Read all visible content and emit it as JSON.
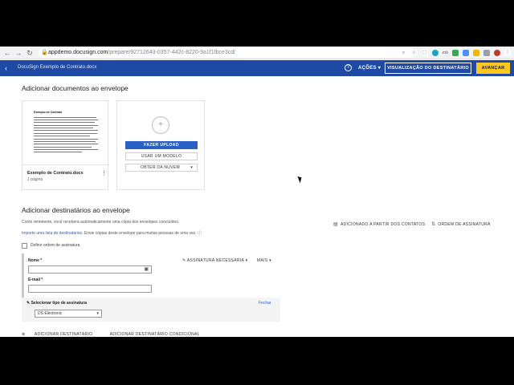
{
  "browser": {
    "url_host": "appdemo.docusign.com",
    "url_path": "/prepare/92712643-0357-442c-8220-9a1f1fbce3cd/",
    "ext_text": "zxk"
  },
  "header": {
    "envelope_title": "DocuSign Exemplo de Contrato.docx",
    "actions_label": "AÇÕES",
    "preview_label": "VISUALIZAÇÃO DO DESTINATÁRIO",
    "next_label": "AVANÇAR"
  },
  "documents": {
    "section_title": "Adicionar documentos ao envelope",
    "doc_thumb_title": "Exemplo de Contrato",
    "doc_name": "Exemplo de Contrato.docx",
    "doc_pages": "1 página",
    "upload_label": "FAZER UPLOAD",
    "template_label": "USAR UM MODELO",
    "cloud_label": "OBTER DA NUVEM"
  },
  "recipients": {
    "section_title": "Adicionar destinatários ao envelope",
    "info_line1": "Como remetente, você receberá automaticamente uma cópia dos envelopes concluídos.",
    "info_link": "Importe uma lista de destinatários",
    "info_line2": ". Envie cópias deste envelope para muitas pessoas de uma vez.",
    "contacts_label": "ADICIONADO A PARTIR DOS CONTATOS",
    "order_label": "ORDEM DE ASSINATURA",
    "signing_order_label": "Definir ordem de assinatura",
    "name_label": "Nome *",
    "email_label": "E-mail *",
    "need_sign_label": "ASSINATURA NECESSÁRIA",
    "more_label": "MAIS",
    "sig_type_label": "Selecionar tipo de assinatura",
    "sig_close_label": "Fechar",
    "sig_type_value": "DS Electronic",
    "add_recipient_label": "ADICIONAR DESTINATÁRIO",
    "add_conditional_label": "ADICIONAR DESTINATÁRIO CONDICIONAL"
  }
}
